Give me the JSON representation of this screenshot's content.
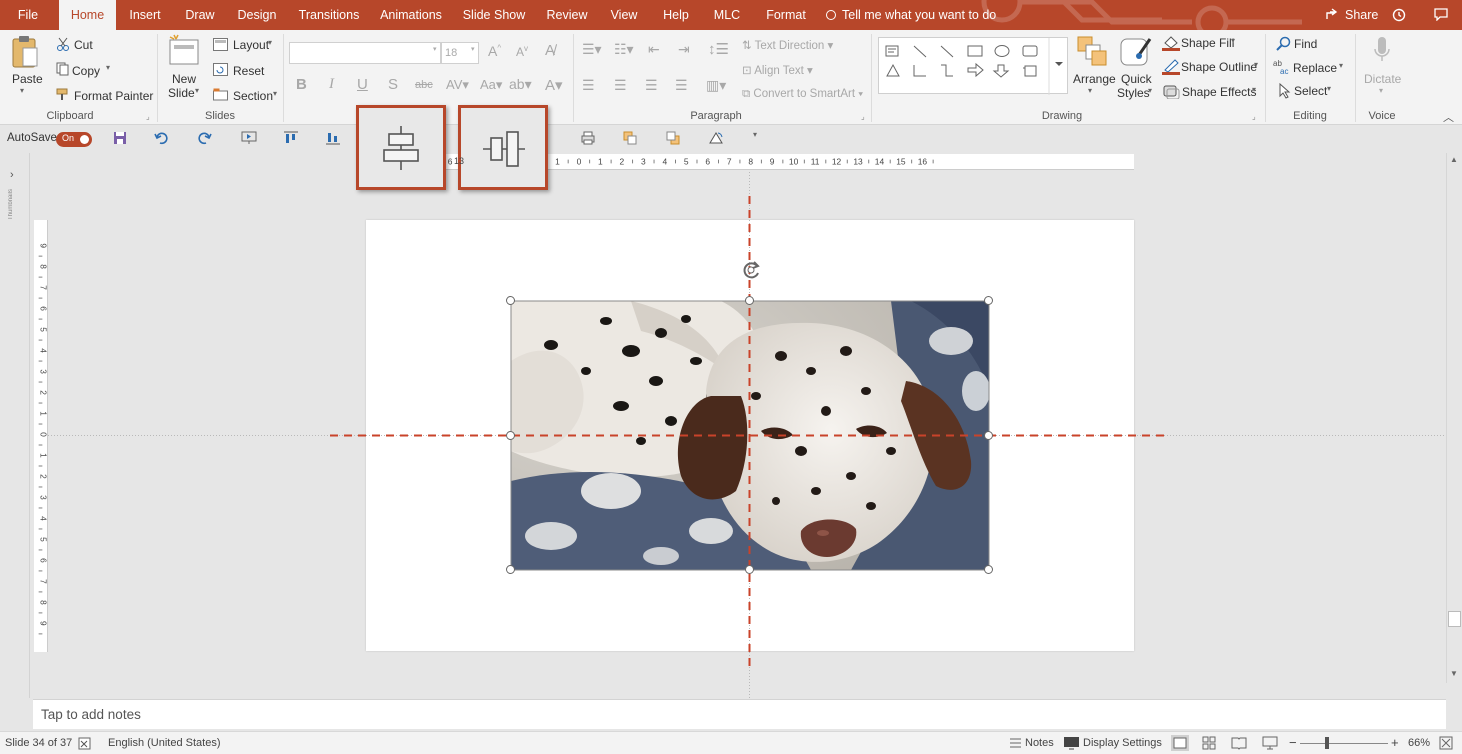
{
  "tabs": [
    "File",
    "Home",
    "Insert",
    "Draw",
    "Design",
    "Transitions",
    "Animations",
    "Slide Show",
    "Review",
    "View",
    "Help",
    "MLC",
    "Format"
  ],
  "tell_me": "Tell me what you want to do",
  "share": "Share",
  "clipboard": {
    "paste": "Paste",
    "cut": "Cut",
    "copy": "Copy",
    "format_painter": "Format Painter",
    "label": "Clipboard"
  },
  "slides": {
    "new_slide_1": "New",
    "new_slide_2": "Slide",
    "layout": "Layout",
    "reset": "Reset",
    "section": "Section",
    "label": "Slides"
  },
  "font": {
    "size": "18"
  },
  "paragraph": {
    "text_direction": "Text Direction",
    "align_text": "Align Text",
    "convert": "Convert to SmartArt",
    "label": "Paragraph"
  },
  "drawing": {
    "arrange": "Arrange",
    "quick_styles_1": "Quick",
    "quick_styles_2": "Styles",
    "shape_fill": "Shape Fill",
    "shape_outline": "Shape Outline",
    "shape_effects": "Shape Effects",
    "label": "Drawing"
  },
  "editing": {
    "find": "Find",
    "replace": "Replace",
    "select": "Select",
    "label": "Editing"
  },
  "voice": {
    "dictate": "Dictate",
    "label": "Voice"
  },
  "qat": {
    "autosave": "AutoSave",
    "toggle": "On"
  },
  "thumbnails_label": "Thumbnails",
  "hruler_ticks": [
    "8",
    "7",
    "6",
    "5",
    "4",
    "3",
    "2",
    "1",
    "0",
    "1",
    "2",
    "3",
    "4",
    "5",
    "6",
    "7",
    "8",
    "9",
    "10",
    "11",
    "12",
    "13",
    "14",
    "15",
    "16"
  ],
  "vruler_ticks": [
    "9",
    "8",
    "7",
    "6",
    "5",
    "4",
    "3",
    "2",
    "1",
    "0",
    "1",
    "2",
    "3",
    "4",
    "5",
    "6",
    "7",
    "8",
    "9"
  ],
  "callout_fragment": "13",
  "notes_placeholder": "Tap to add notes",
  "status": {
    "slide": "Slide 34 of 37",
    "language": "English (United States)",
    "notes": "Notes",
    "display": "Display Settings",
    "zoom": "66%"
  },
  "colors": {
    "accent": "#b7472a",
    "guide": "#c9432a"
  }
}
